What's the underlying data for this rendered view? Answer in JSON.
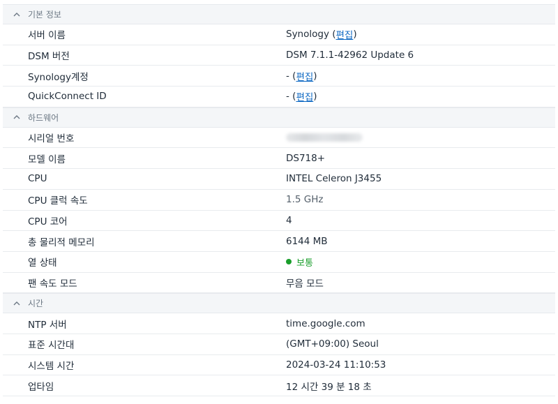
{
  "sections": {
    "basic": {
      "title": "기본 정보",
      "server_name": {
        "label": "서버 이름",
        "value": "Synology",
        "edit": "편집"
      },
      "dsm_version": {
        "label": "DSM 버전",
        "value": "DSM 7.1.1-42962 Update 6"
      },
      "synology_account": {
        "label": "Synology계정",
        "value": "-",
        "edit": "편집"
      },
      "quickconnect": {
        "label": "QuickConnect ID",
        "value": "-",
        "edit": "편집"
      }
    },
    "hardware": {
      "title": "하드웨어",
      "serial": {
        "label": "시리얼 번호"
      },
      "model": {
        "label": "모델 이름",
        "value": "DS718+"
      },
      "cpu": {
        "label": "CPU",
        "value": "INTEL Celeron J3455"
      },
      "cpu_clock": {
        "label": "CPU 클럭 속도",
        "value": "1.5 GHz"
      },
      "cpu_cores": {
        "label": "CPU 코어",
        "value": "4"
      },
      "memory": {
        "label": "총 물리적 메모리",
        "value": "6144 MB"
      },
      "thermal": {
        "label": "열 상태",
        "value": "보통",
        "color": "#1a9e2b"
      },
      "fan": {
        "label": "팬 속도 모드",
        "value": "무음 모드"
      }
    },
    "time": {
      "title": "시간",
      "ntp": {
        "label": "NTP 서버",
        "value": "time.google.com"
      },
      "timezone": {
        "label": "표준 시간대",
        "value": "(GMT+09:00) Seoul"
      },
      "system_time": {
        "label": "시스템 시간",
        "value": "2024-03-24 11:10:53"
      },
      "uptime": {
        "label": "업타임",
        "value": "12 시간 39 분 18 초"
      }
    }
  },
  "icons": {
    "collapse": "chevron-up-icon",
    "status": "status-dot-icon"
  }
}
